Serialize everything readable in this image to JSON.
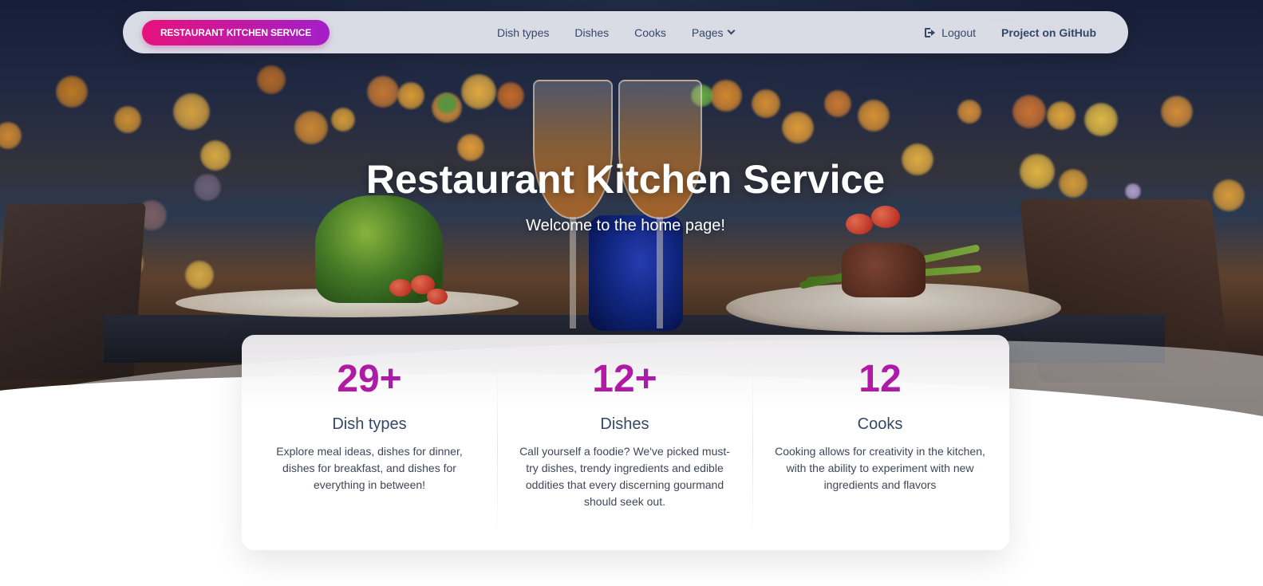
{
  "navbar": {
    "brand": "RESTAURANT KITCHEN SERVICE",
    "links": [
      {
        "label": "Dish types"
      },
      {
        "label": "Dishes"
      },
      {
        "label": "Cooks"
      },
      {
        "label": "Pages",
        "icon": "chevron-down-icon"
      }
    ],
    "logout_label": "Logout",
    "logout_icon": "sign-out-icon",
    "github_label": "Project on GitHub"
  },
  "hero": {
    "title": "Restaurant Kitchen Service",
    "subtitle": "Welcome to the home page!"
  },
  "stats": [
    {
      "value": "29+",
      "title": "Dish types",
      "description": "Explore meal ideas, dishes for dinner, dishes for breakfast, and dishes for everything in between!"
    },
    {
      "value": "12+",
      "title": "Dishes",
      "description": "Call yourself a foodie? We've picked must-try dishes, trendy ingredients and edible oddities that every discerning gourmand should seek out."
    },
    {
      "value": "12",
      "title": "Cooks",
      "description": "Cooking allows for creativity in the kitchen, with the ability to experiment with new ingredients and flavors"
    }
  ],
  "colors": {
    "brand_gradient_start": "#e6127c",
    "brand_gradient_end": "#a21fc8",
    "stat_number": "#b21aa4",
    "text_dark": "#344767"
  }
}
